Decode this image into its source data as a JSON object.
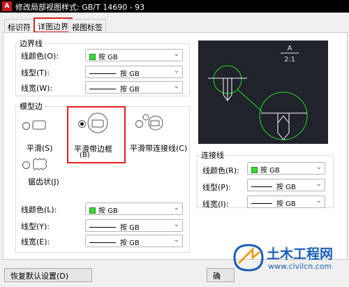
{
  "window": {
    "title": "修改局部视图样式: GB/T 14690 - 93",
    "app_icon_letter": "A"
  },
  "tabs": [
    {
      "label": "标识符"
    },
    {
      "label": "详图边界"
    },
    {
      "label": "视图标签"
    }
  ],
  "boundary_lines": {
    "title": "边界线",
    "color_label": "线颜色(O):",
    "color_value": "按 GB",
    "linetype_label": "线型(T):",
    "linetype_value": "按 GB",
    "lineweight_label": "线宽(W):",
    "lineweight_value": "按 GB"
  },
  "model_edge": {
    "title": "模型边",
    "options": [
      {
        "label": "平滑(S)"
      },
      {
        "label": "平滑带边框",
        "shortcut": "(B)"
      },
      {
        "label": "平滑带连接线(C)"
      },
      {
        "label": "锯齿状(J)"
      }
    ],
    "color_label": "线颜色(L):",
    "color_value": "按 GB",
    "linetype_label": "线型(Y):",
    "linetype_value": "按 GB",
    "lineweight_label": "线宽(E):",
    "lineweight_value": "按 GB"
  },
  "preview": {
    "label": "A",
    "scale": "2:1"
  },
  "connection_lines": {
    "title": "连接线",
    "color_label": "线颜色(R):",
    "color_value": "按 GB",
    "linetype_label": "线型(P):",
    "linetype_value": "按 GB",
    "lineweight_label": "线宽(I):",
    "lineweight_value": "按 GB"
  },
  "footer": {
    "restore_label": "恢复默认设置(D)",
    "partial_button": "确"
  },
  "watermark": {
    "cn": "土木工程网",
    "url": "www.civilcn.com"
  },
  "colors": {
    "accent_red": "#e02020",
    "swatch_green": "#33dd33",
    "preview_bg": "#20232b",
    "watermark_blue": "#1a5fb4"
  }
}
